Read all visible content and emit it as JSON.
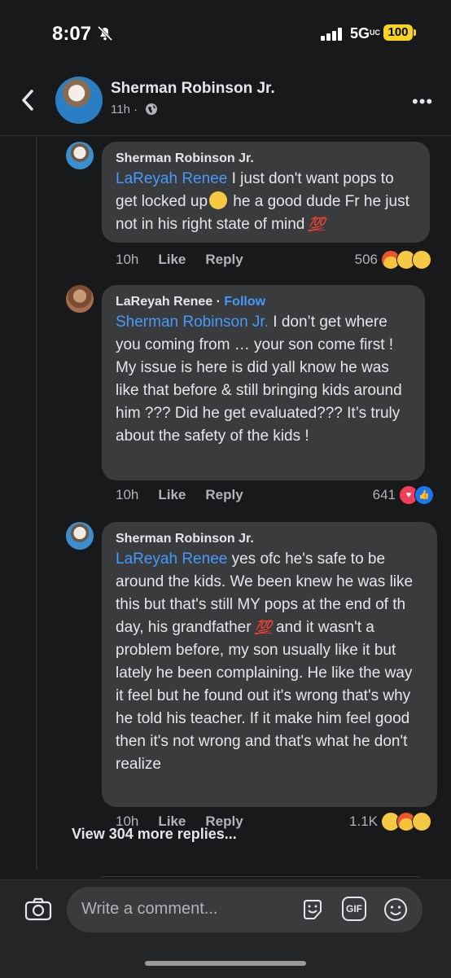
{
  "status": {
    "time": "8:07",
    "network": "5G",
    "network_suffix": "UC",
    "battery": "100"
  },
  "header": {
    "name": "Sherman Robinson Jr.",
    "time": "11h ·"
  },
  "comments": [
    {
      "author": "Sherman Robinson Jr.",
      "mention": "LaReyah Renee",
      "text_a": " I just don't want pops to get locked up",
      "text_b": " he a good dude Fr he just not in his right state of mind",
      "hundred": "💯",
      "time": "10h",
      "like": "Like",
      "reply": "Reply",
      "count": "506",
      "reactions": [
        "angry",
        "wow",
        "sad"
      ]
    },
    {
      "author": "LaReyah Renee",
      "follow": "Follow",
      "mention": "Sherman Robinson Jr.",
      "text": " I don’t get where you coming from … your son come first ! My issue is here is did yall know he was like that before & still bringing kids around him ??? Did he get evaluated??? It’s truly about the safety of the kids !",
      "time": "10h",
      "like": "Like",
      "reply": "Reply",
      "count": "641",
      "reactions": [
        "love",
        "like"
      ]
    },
    {
      "author": "Sherman Robinson Jr.",
      "mention": "LaReyah Renee",
      "text_a": " yes ofc he's safe to be around the kids. We been knew he was like this but that's still MY pops at the end of th day, his grandfather",
      "hundred": "💯",
      "text_b": " and it wasn't a problem before, my son usually like it but lately he been complaining. He like the way it feel but he found out it's wrong that's why he told his teacher. If it make him feel good then it's not wrong and that's what he don't realize",
      "time": "10h",
      "like": "Like",
      "reply": "Reply",
      "count": "1.1K",
      "reactions": [
        "wow",
        "angry",
        "sad"
      ]
    }
  ],
  "view_more": "View 304 more replies...",
  "composer": {
    "placeholder": "Write a comment...",
    "gif": "GIF"
  }
}
